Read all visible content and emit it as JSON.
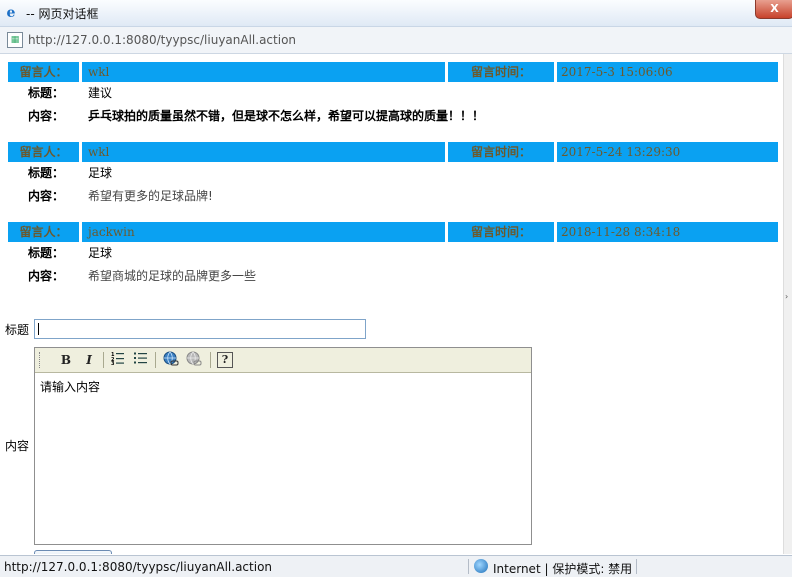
{
  "window": {
    "title": "-- 网页对话框",
    "close_label": "X",
    "address": "http://127.0.0.1:8080/tyypsc/liuyanAll.action"
  },
  "messages": [
    {
      "author_label": "留言人：",
      "author": "wkl",
      "time_label": "留言时间：",
      "time": "2017-5-3 15:06:06",
      "title_label": "标题：",
      "title": "建议",
      "content_label": "内容：",
      "content": "乒乓球拍的质量虽然不错，但是球不怎么样，希望可以提高球的质量！！！"
    },
    {
      "author_label": "留言人：",
      "author": "wkl",
      "time_label": "留言时间：",
      "time": "2017-5-24 13:29:30",
      "title_label": "标题：",
      "title": "足球",
      "content_label": "内容：",
      "content": "希望有更多的足球品牌!"
    },
    {
      "author_label": "留言人：",
      "author": "jackwin",
      "time_label": "留言时间：",
      "time": "2018-11-28 8:34:18",
      "title_label": "标题：",
      "title": "足球",
      "content_label": "内容：",
      "content": "希望商城的足球的品牌更多一些"
    }
  ],
  "form": {
    "title_label": "标题",
    "title_value": "",
    "content_label": "内容",
    "content_placeholder": "请输入内容",
    "toolbar": {
      "bold": "B",
      "italic": "I",
      "help": "?"
    }
  },
  "status": {
    "url": "http://127.0.0.1:8080/tyypsc/liuyanAll.action",
    "zone": "Internet | 保护模式: 禁用"
  }
}
